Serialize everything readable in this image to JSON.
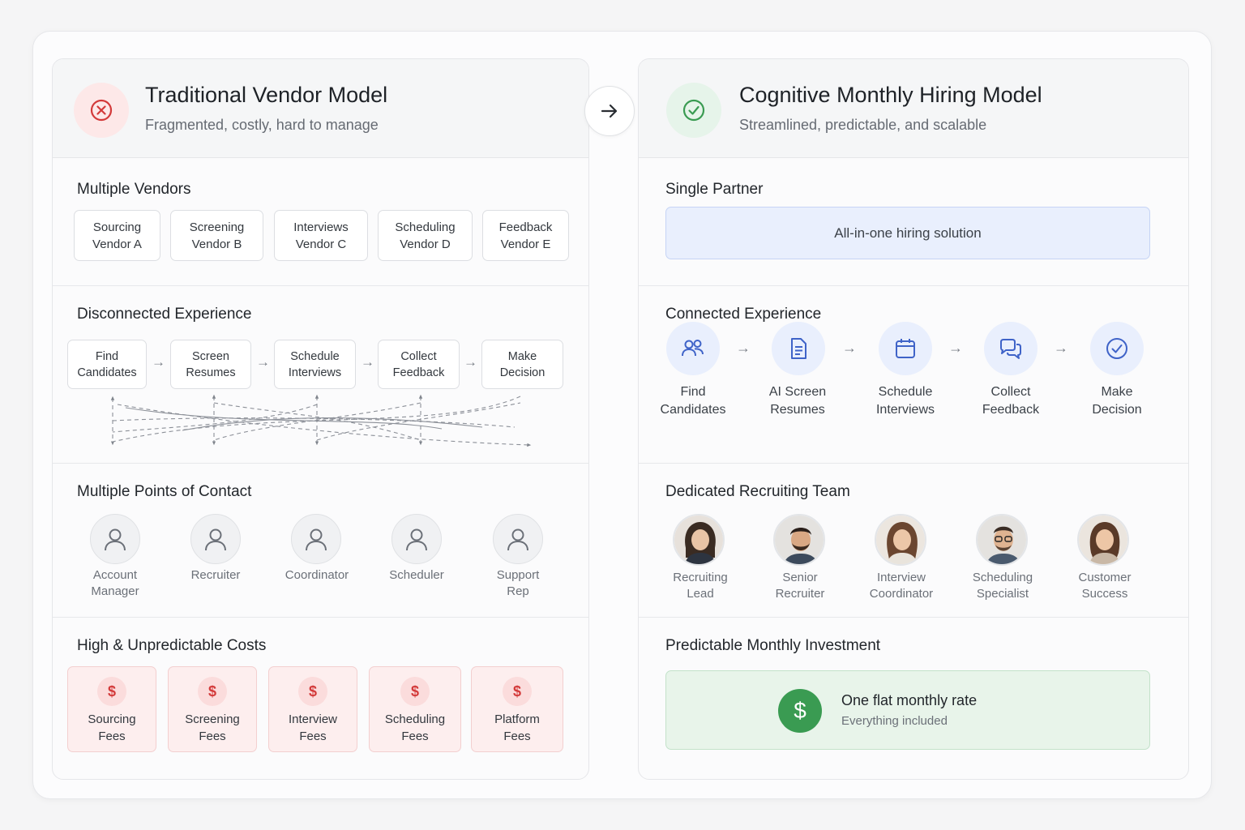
{
  "left": {
    "title": "Traditional Vendor Model",
    "subtitle": "Fragmented, costly, hard to manage",
    "vendors": {
      "title": "Multiple Vendors",
      "items": [
        {
          "l1": "Sourcing",
          "l2": "Vendor A"
        },
        {
          "l1": "Screening",
          "l2": "Vendor B"
        },
        {
          "l1": "Interviews",
          "l2": "Vendor C"
        },
        {
          "l1": "Scheduling",
          "l2": "Vendor D"
        },
        {
          "l1": "Feedback",
          "l2": "Vendor E"
        }
      ]
    },
    "experience": {
      "title": "Disconnected Experience",
      "steps": [
        {
          "l1": "Find",
          "l2": "Candidates"
        },
        {
          "l1": "Screen",
          "l2": "Resumes"
        },
        {
          "l1": "Schedule",
          "l2": "Interviews"
        },
        {
          "l1": "Collect",
          "l2": "Feedback"
        },
        {
          "l1": "Make",
          "l2": "Decision"
        }
      ]
    },
    "contacts": {
      "title": "Multiple Points of Contact",
      "items": [
        {
          "l1": "Account",
          "l2": "Manager"
        },
        {
          "l1": "Recruiter",
          "l2": ""
        },
        {
          "l1": "Coordinator",
          "l2": ""
        },
        {
          "l1": "Scheduler",
          "l2": ""
        },
        {
          "l1": "Support",
          "l2": "Rep"
        }
      ]
    },
    "costs": {
      "title": "High & Unpredictable Costs",
      "symbol": "$",
      "items": [
        {
          "l1": "Sourcing",
          "l2": "Fees"
        },
        {
          "l1": "Screening",
          "l2": "Fees"
        },
        {
          "l1": "Interview",
          "l2": "Fees"
        },
        {
          "l1": "Scheduling",
          "l2": "Fees"
        },
        {
          "l1": "Platform",
          "l2": "Fees"
        }
      ]
    }
  },
  "right": {
    "title": "Cognitive Monthly Hiring Model",
    "subtitle": "Streamlined, predictable, and scalable",
    "partner": {
      "title": "Single Partner",
      "label": "All-in-one hiring solution"
    },
    "experience": {
      "title": "Connected Experience",
      "steps": [
        {
          "icon": "people-icon",
          "l1": "Find",
          "l2": "Candidates"
        },
        {
          "icon": "document-icon",
          "l1": "AI Screen",
          "l2": "Resumes"
        },
        {
          "icon": "calendar-icon",
          "l1": "Schedule",
          "l2": "Interviews"
        },
        {
          "icon": "chat-icon",
          "l1": "Collect",
          "l2": "Feedback"
        },
        {
          "icon": "check-circle-icon",
          "l1": "Make",
          "l2": "Decision"
        }
      ]
    },
    "team": {
      "title": "Dedicated Recruiting Team",
      "members": [
        {
          "l1": "Recruiting",
          "l2": "Lead"
        },
        {
          "l1": "Senior",
          "l2": "Recruiter"
        },
        {
          "l1": "Interview",
          "l2": "Coordinator"
        },
        {
          "l1": "Scheduling",
          "l2": "Specialist"
        },
        {
          "l1": "Customer",
          "l2": "Success"
        }
      ]
    },
    "investment": {
      "title": "Predictable Monthly Investment",
      "symbol": "$",
      "rate": "One flat monthly rate",
      "note": "Everything included"
    }
  },
  "colors": {
    "negative": "#d33a3a",
    "positive": "#3a9b52",
    "accent": "#3f63c8"
  }
}
